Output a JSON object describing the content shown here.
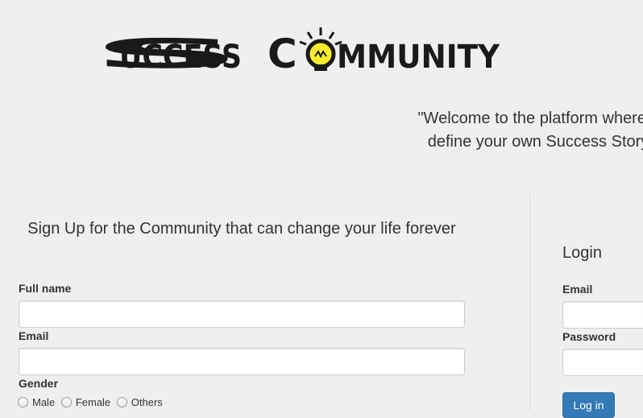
{
  "brand": {
    "logo_text": "SUCCESS COMMUNITY",
    "colors": {
      "logo": "#1a1a1a",
      "bulb": "#f7ec2b",
      "bulb_outline": "#1a1a1a"
    }
  },
  "tagline": {
    "line1": "\"Welcome to the platform where y",
    "line2": "define your own Success Story"
  },
  "signup": {
    "title": "Sign Up for the Community that can change your life forever",
    "fullname_label": "Full name",
    "email_label": "Email",
    "gender_label": "Gender",
    "gender_options": [
      "Male",
      "Female",
      "Others"
    ]
  },
  "login": {
    "title": "Login",
    "email_label": "Email",
    "password_label": "Password",
    "submit_label": "Log in"
  },
  "colors": {
    "background": "#efefef",
    "primary_button": "#337ab7",
    "text": "#333333"
  }
}
